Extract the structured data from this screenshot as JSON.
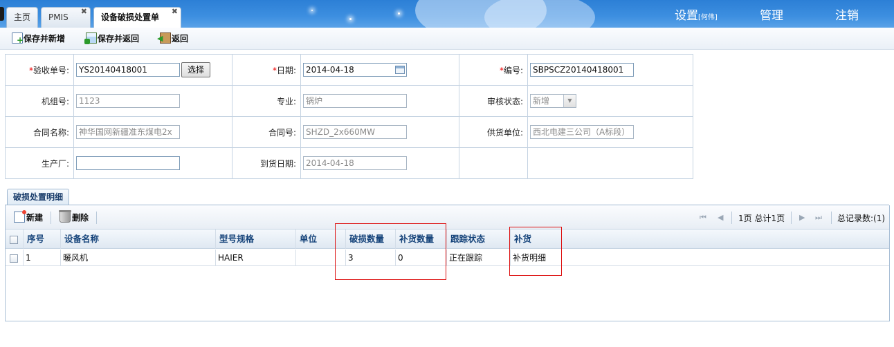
{
  "header": {
    "tabs": [
      {
        "label": "主页"
      },
      {
        "label": "PMIS",
        "close": "✖"
      },
      {
        "label": "设备破损处置单",
        "close": "✖"
      }
    ],
    "links": {
      "settings": "设置",
      "settings_user": "[何伟]",
      "manage": "管理",
      "logout": "注销"
    }
  },
  "toolbar": {
    "save_new": "保存并新增",
    "save_return": "保存并返回",
    "back": "返回"
  },
  "form": {
    "receipt_no": {
      "label": "验收单号:",
      "value": "YS20140418001",
      "select": "选择"
    },
    "date": {
      "label": "日期:",
      "value": "2014-04-18"
    },
    "code": {
      "label": "编号:",
      "value": "SBPSCZ20140418001"
    },
    "unit_no": {
      "label": "机组号:",
      "value": "1123"
    },
    "major": {
      "label": "专业:",
      "value": "锅炉"
    },
    "review_status": {
      "label": "审核状态:",
      "value": "新增"
    },
    "contract_name": {
      "label": "合同名称:",
      "value": "神华国网新疆准东煤电2x"
    },
    "contract_no": {
      "label": "合同号:",
      "value": "SHZD_2x660MW"
    },
    "supplier": {
      "label": "供货单位:",
      "value": "西北电建三公司（A标段）"
    },
    "manufacturer": {
      "label": "生产厂:",
      "value": ""
    },
    "arrival_date": {
      "label": "到货日期:",
      "value": "2014-04-18"
    },
    "required_mark": "*"
  },
  "detail_tab": "破损处置明细",
  "grid": {
    "new": "新建",
    "delete": "删除",
    "pager": {
      "page_info": "1页 总计1页",
      "total": "总记录数:(1)",
      "first": "⏮",
      "prev": "◀",
      "next": "▶",
      "last": "⏭"
    },
    "columns": [
      "序号",
      "设备名称",
      "型号规格",
      "单位",
      "破损数量",
      "补货数量",
      "跟踪状态",
      "补货"
    ],
    "rows": [
      [
        "1",
        "暖风机",
        "HAIER",
        "",
        "3",
        "0",
        "正在跟踪",
        "补货明细"
      ]
    ]
  }
}
